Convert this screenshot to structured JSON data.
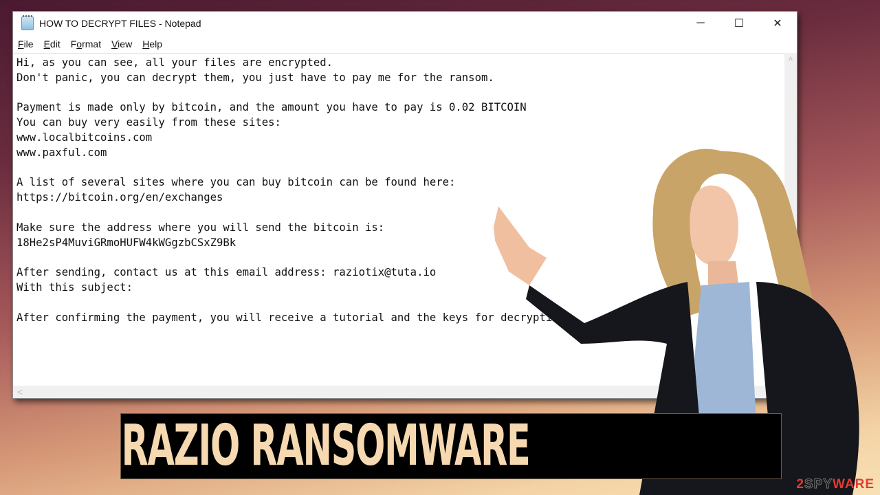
{
  "window": {
    "title": "HOW TO DECRYPT FILES - Notepad",
    "app_icon": "notepad-icon",
    "controls": {
      "minimize": "─",
      "maximize": "☐",
      "close": "✕"
    }
  },
  "menubar": {
    "items": [
      {
        "accel": "F",
        "rest": "ile"
      },
      {
        "accel": "E",
        "rest": "dit"
      },
      {
        "pre": "F",
        "accel": "o",
        "rest": "rmat"
      },
      {
        "accel": "V",
        "rest": "iew"
      },
      {
        "accel": "H",
        "rest": "elp"
      }
    ]
  },
  "document": {
    "text": "Hi, as you can see, all your files are encrypted.\nDon't panic, you can decrypt them, you just have to pay me for the ransom.\n\nPayment is made only by bitcoin, and the amount you have to pay is 0.02 BITCOIN\nYou can buy very easily from these sites:\nwww.localbitcoins.com\nwww.paxful.com\n\nA list of several sites where you can buy bitcoin can be found here:\nhttps://bitcoin.org/en/exchanges\n\nMake sure the address where you will send the bitcoin is:\n18He2sP4MuviGRmoHUFW4kWGgzbCSxZ9Bk\n\nAfter sending, contact us at this email address: raziotix@tuta.io\nWith this subject:\n\nAfter confirming the payment, you will receive a tutorial and the keys for decrypting"
  },
  "scroll": {
    "up": "˄",
    "left": "<"
  },
  "banner": {
    "text": "RAZIO RANSOMWARE"
  },
  "watermark": {
    "two": "2",
    "spy": "SPY",
    "ware": "WARE"
  }
}
